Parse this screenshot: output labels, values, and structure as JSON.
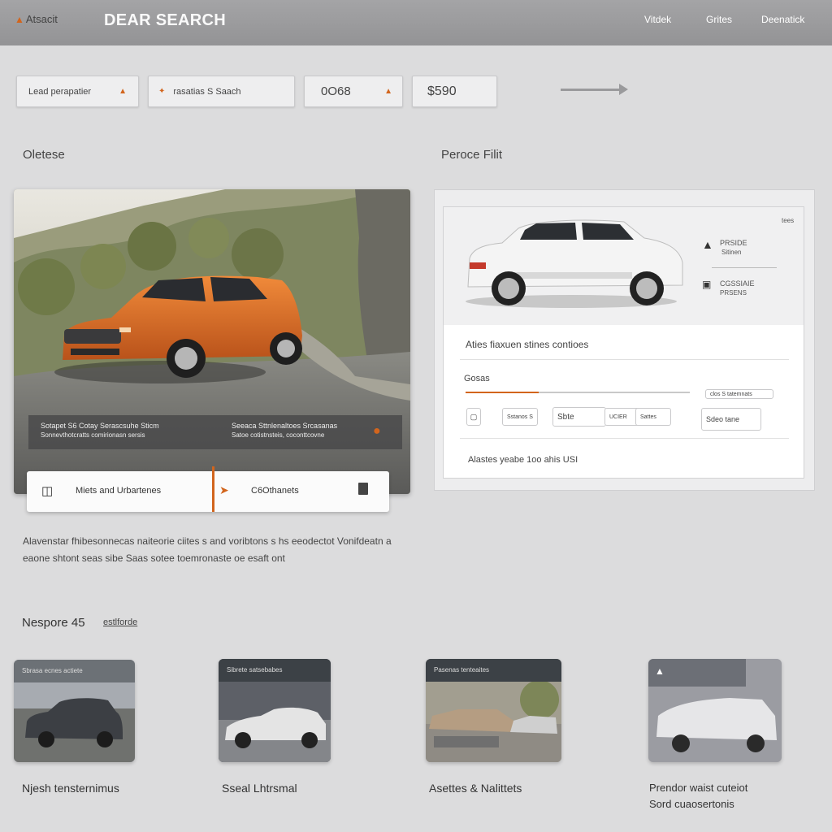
{
  "header": {
    "logo_text": "Atsacit",
    "title": "DEAR SEARCH",
    "nav": [
      "Vitdek",
      "Grites",
      "Deenatick"
    ]
  },
  "search": {
    "field1": "Lead perapatier",
    "field2": "rasatias S Saach",
    "field3": "0O68",
    "price": "$590"
  },
  "sections": {
    "left_title": "Oletese",
    "right_title": "Peroce Filit"
  },
  "hero": {
    "caption_left_1": "Sotapet S6 Cotay Serascsuhe Sticm",
    "caption_left_2": "Sonnevthotcratts comirionasn sersis",
    "caption_right_1": "Seeaca Sttnlenaltoes Srcasanas",
    "caption_right_2": "Satoe cotistnsteis, coconttcovne",
    "card_left": "Miets and Urbartenes",
    "card_right": "C6Othanets"
  },
  "filter": {
    "corner": "tees",
    "opt1_label": "PRSIDE",
    "opt1_sub": "Sitinen",
    "opt2_label": "CGSSIAIE",
    "opt2_sub": "PRSENS",
    "subtitle": "Aties fiaxuen stines contioes",
    "section": "Gosas",
    "slider_tag": "clos S tatemnats",
    "chip1": "Sstanos S",
    "chip2": "Sbte",
    "chip3": "UCIER",
    "chip4": "Sattes",
    "chip5": "Sdeo tane",
    "footer": "Alastes yeabe 1oo ahis USI"
  },
  "description": "Alavenstar fhibesonnecas naiteorie ciites s and voribtons s hs eeodectot Vonifdeatn a eaone shtont seas sibe Saas sotee toemronaste oe esaft ont",
  "related": {
    "title": "Nespore 45",
    "link": "estlforde",
    "cards": [
      {
        "header": "Sbrasa ecnes actiete",
        "title": "Njesh tensternimus"
      },
      {
        "header": "Sibrete satsebabes",
        "title": "Sseal Lhtrsmal"
      },
      {
        "header": "Pasenas tenteaites",
        "title": "Asettes & Nalittets"
      },
      {
        "header": "",
        "title": "Prendor waist cuteiot",
        "title2": "Sord cuaosertonis"
      }
    ]
  },
  "colors": {
    "accent": "#d2651d",
    "header_bg": "#9b9b9d",
    "page_bg": "#dcdcdd"
  }
}
